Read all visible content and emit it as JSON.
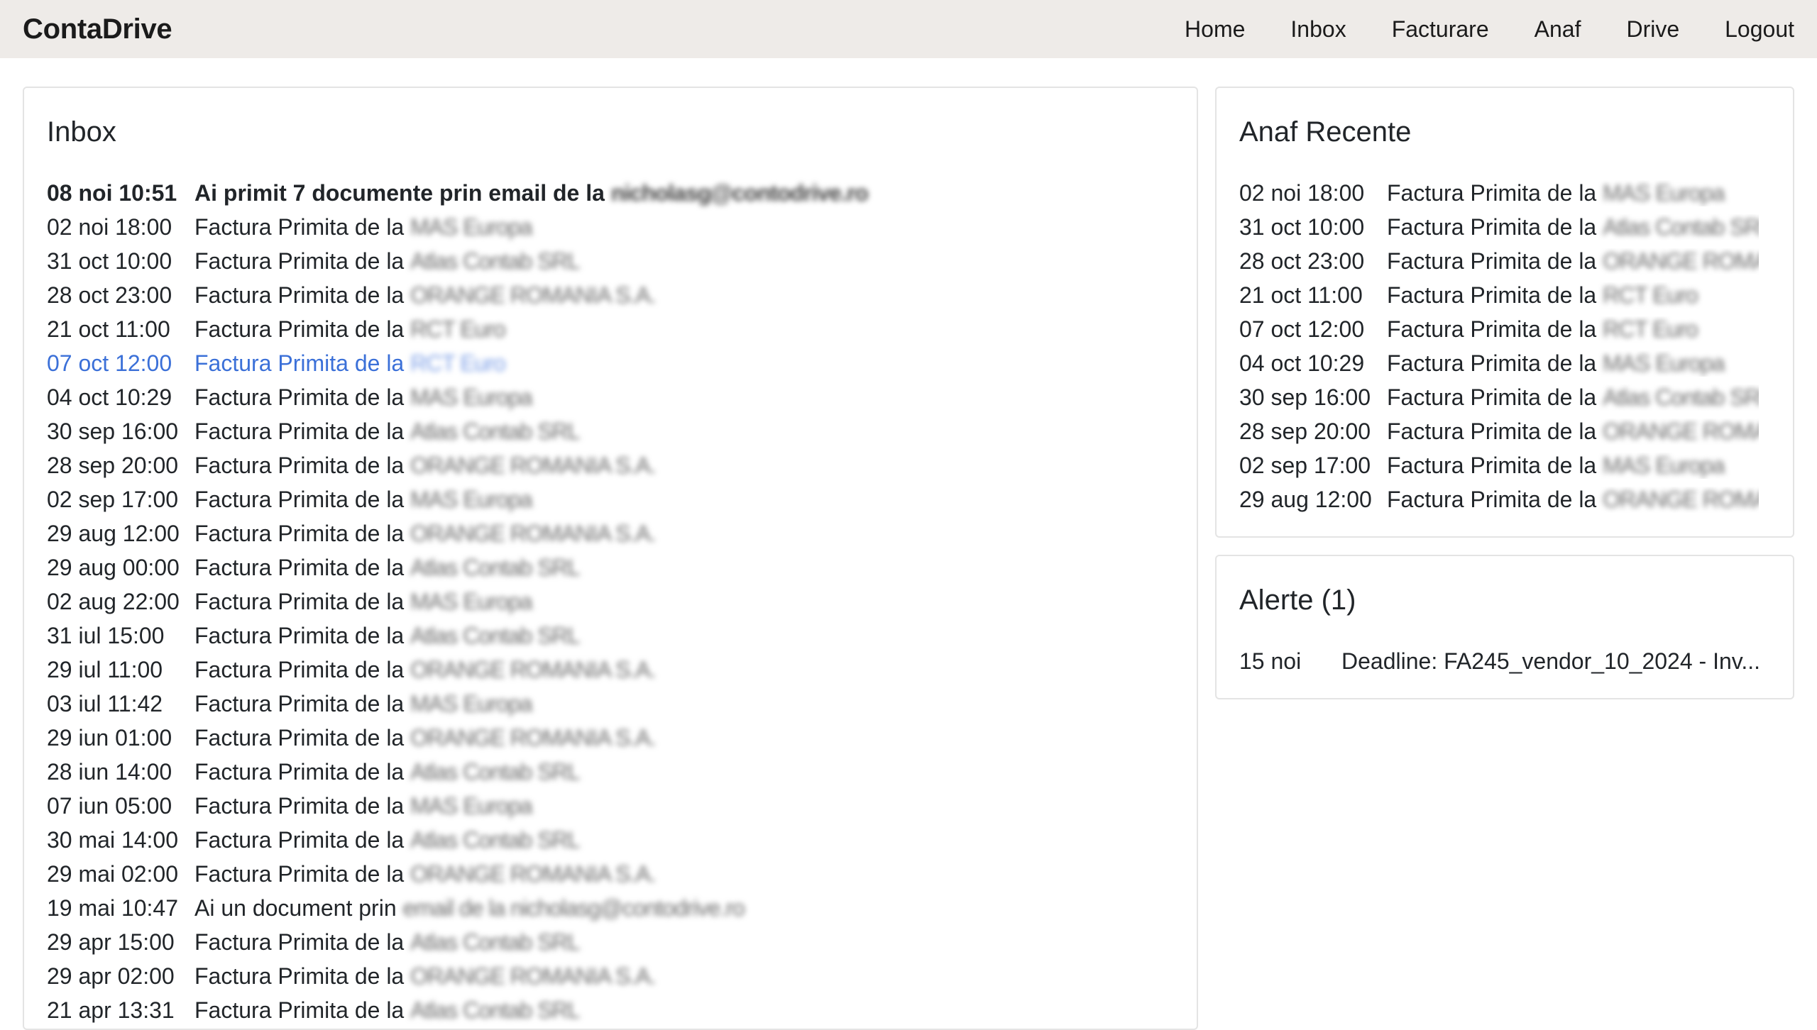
{
  "navbar": {
    "brand": "ContaDrive",
    "links": [
      "Home",
      "Inbox",
      "Facturare",
      "Anaf",
      "Drive",
      "Logout"
    ]
  },
  "inbox": {
    "title": "Inbox",
    "items": [
      {
        "date": "08 noi 10:51",
        "prefix": "Ai primit 7 documente prin email de la ",
        "redacted": "nicholasg@contodrive.ro"
      },
      {
        "date": "02 noi 18:00",
        "prefix": "Factura Primita de la ",
        "redacted": "MAS Europa"
      },
      {
        "date": "31 oct 10:00",
        "prefix": "Factura Primita de la ",
        "redacted": "Atlas Contab SRL"
      },
      {
        "date": "28 oct 23:00",
        "prefix": "Factura Primita de la ",
        "redacted": "ORANGE ROMANIA S.A."
      },
      {
        "date": "21 oct 11:00",
        "prefix": "Factura Primita de la ",
        "redacted": "RCT Euro"
      },
      {
        "date": "07 oct 12:00",
        "prefix": "Factura Primita de la ",
        "redacted": "RCT Euro"
      },
      {
        "date": "04 oct 10:29",
        "prefix": "Factura Primita de la ",
        "redacted": "MAS Europa"
      },
      {
        "date": "30 sep 16:00",
        "prefix": "Factura Primita de la ",
        "redacted": "Atlas Contab SRL"
      },
      {
        "date": "28 sep 20:00",
        "prefix": "Factura Primita de la ",
        "redacted": "ORANGE ROMANIA S.A."
      },
      {
        "date": "02 sep 17:00",
        "prefix": "Factura Primita de la ",
        "redacted": "MAS Europa"
      },
      {
        "date": "29 aug 12:00",
        "prefix": "Factura Primita de la ",
        "redacted": "ORANGE ROMANIA S.A."
      },
      {
        "date": "29 aug 00:00",
        "prefix": "Factura Primita de la ",
        "redacted": "Atlas Contab SRL"
      },
      {
        "date": "02 aug 22:00",
        "prefix": "Factura Primita de la ",
        "redacted": "MAS Europa"
      },
      {
        "date": "31 iul 15:00",
        "prefix": "Factura Primita de la ",
        "redacted": "Atlas Contab SRL"
      },
      {
        "date": "29 iul 11:00",
        "prefix": "Factura Primita de la ",
        "redacted": "ORANGE ROMANIA S.A."
      },
      {
        "date": "03 iul 11:42",
        "prefix": "Factura Primita de la ",
        "redacted": "MAS Europa"
      },
      {
        "date": "29 iun 01:00",
        "prefix": "Factura Primita de la ",
        "redacted": "ORANGE ROMANIA S.A."
      },
      {
        "date": "28 iun 14:00",
        "prefix": "Factura Primita de la ",
        "redacted": "Atlas Contab SRL"
      },
      {
        "date": "07 iun 05:00",
        "prefix": "Factura Primita de la ",
        "redacted": "MAS Europa"
      },
      {
        "date": "30 mai 14:00",
        "prefix": "Factura Primita de la ",
        "redacted": "Atlas Contab SRL"
      },
      {
        "date": "29 mai 02:00",
        "prefix": "Factura Primita de la ",
        "redacted": "ORANGE ROMANIA S.A."
      },
      {
        "date": "19 mai 10:47",
        "prefix": "Ai un document prin ",
        "redacted": "email de la nicholasg@contodrive.ro"
      },
      {
        "date": "29 apr 15:00",
        "prefix": "Factura Primita de la ",
        "redacted": "Atlas Contab SRL"
      },
      {
        "date": "29 apr 02:00",
        "prefix": "Factura Primita de la ",
        "redacted": "ORANGE ROMANIA S.A."
      },
      {
        "date": "21 apr 13:31",
        "prefix": "Factura Primita de la ",
        "redacted": "Atlas Contab SRL"
      }
    ]
  },
  "anaf": {
    "title": "Anaf Recente",
    "items": [
      {
        "date": "02 noi 18:00",
        "prefix": "Factura Primita de la ",
        "redacted": "MAS Europa"
      },
      {
        "date": "31 oct 10:00",
        "prefix": "Factura Primita de la ",
        "redacted": "Atlas Contab SRL"
      },
      {
        "date": "28 oct 23:00",
        "prefix": "Factura Primita de la ",
        "redacted": "ORANGE ROMANIA S.A."
      },
      {
        "date": "21 oct 11:00",
        "prefix": "Factura Primita de la ",
        "redacted": "RCT Euro"
      },
      {
        "date": "07 oct 12:00",
        "prefix": "Factura Primita de la ",
        "redacted": "RCT Euro"
      },
      {
        "date": "04 oct 10:29",
        "prefix": "Factura Primita de la ",
        "redacted": "MAS Europa"
      },
      {
        "date": "30 sep 16:00",
        "prefix": "Factura Primita de la ",
        "redacted": "Atlas Contab SRL"
      },
      {
        "date": "28 sep 20:00",
        "prefix": "Factura Primita de la ",
        "redacted": "ORANGE ROMANIA S.A."
      },
      {
        "date": "02 sep 17:00",
        "prefix": "Factura Primita de la ",
        "redacted": "MAS Europa"
      },
      {
        "date": "29 aug 12:00",
        "prefix": "Factura Primita de la ",
        "redacted": "ORANGE ROMANIA S.A."
      }
    ]
  },
  "alerte": {
    "title": "Alerte (1)",
    "items": [
      {
        "date": "15 noi",
        "text": "Deadline: FA245_vendor_10_2024 - Inv..."
      }
    ]
  },
  "colors": {
    "navbar_bg": "#eeebe8",
    "link_active": "#3b70d8",
    "card_border": "#e4e4e4"
  }
}
